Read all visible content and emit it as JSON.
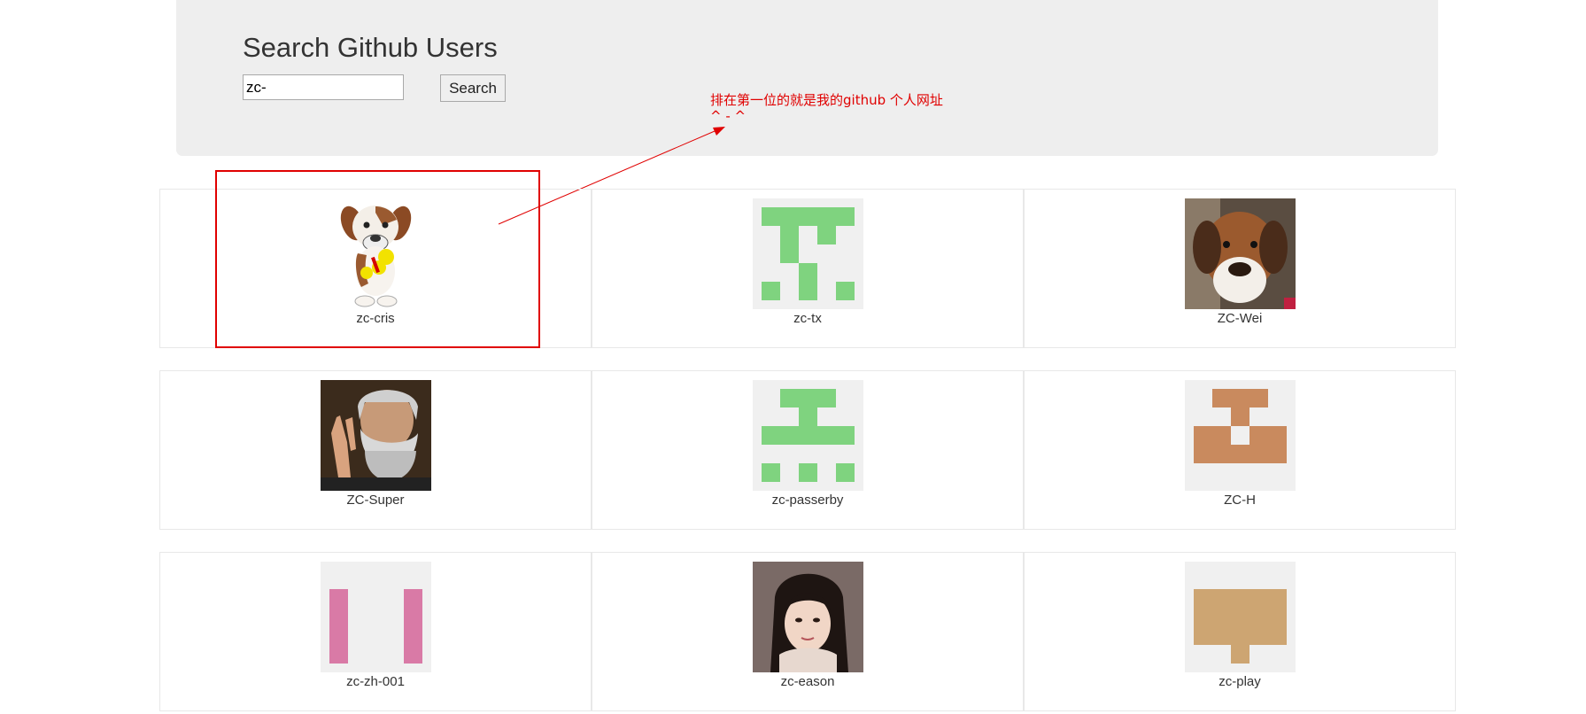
{
  "header": {
    "title": "Search Github Users",
    "search_value": "zc-",
    "search_button_label": "Search"
  },
  "annotation": {
    "line1": "排在第一位的就是我的github 个人网址",
    "line2": "^ - ^",
    "color": "#e00000"
  },
  "users": [
    {
      "login": "zc-cris",
      "avatar": "dog-avatar-icon"
    },
    {
      "login": "zc-tx",
      "avatar": "green-identicon"
    },
    {
      "login": "ZC-Wei",
      "avatar": "plush-dog-photo"
    },
    {
      "login": "ZC-Super",
      "avatar": "bearded-man-photo"
    },
    {
      "login": "zc-passerby",
      "avatar": "green-identicon"
    },
    {
      "login": "ZC-H",
      "avatar": "brown-identicon"
    },
    {
      "login": "zc-zh-001",
      "avatar": "pink-identicon"
    },
    {
      "login": "zc-eason",
      "avatar": "woman-photo"
    },
    {
      "login": "zc-play",
      "avatar": "tan-identicon"
    }
  ],
  "colors": {
    "jumbotron_bg": "#eeeeee",
    "identicon_green": "#7fd37f",
    "identicon_brown": "#c98a5e",
    "identicon_pink": "#d97aa6",
    "identicon_tan": "#cda572"
  }
}
